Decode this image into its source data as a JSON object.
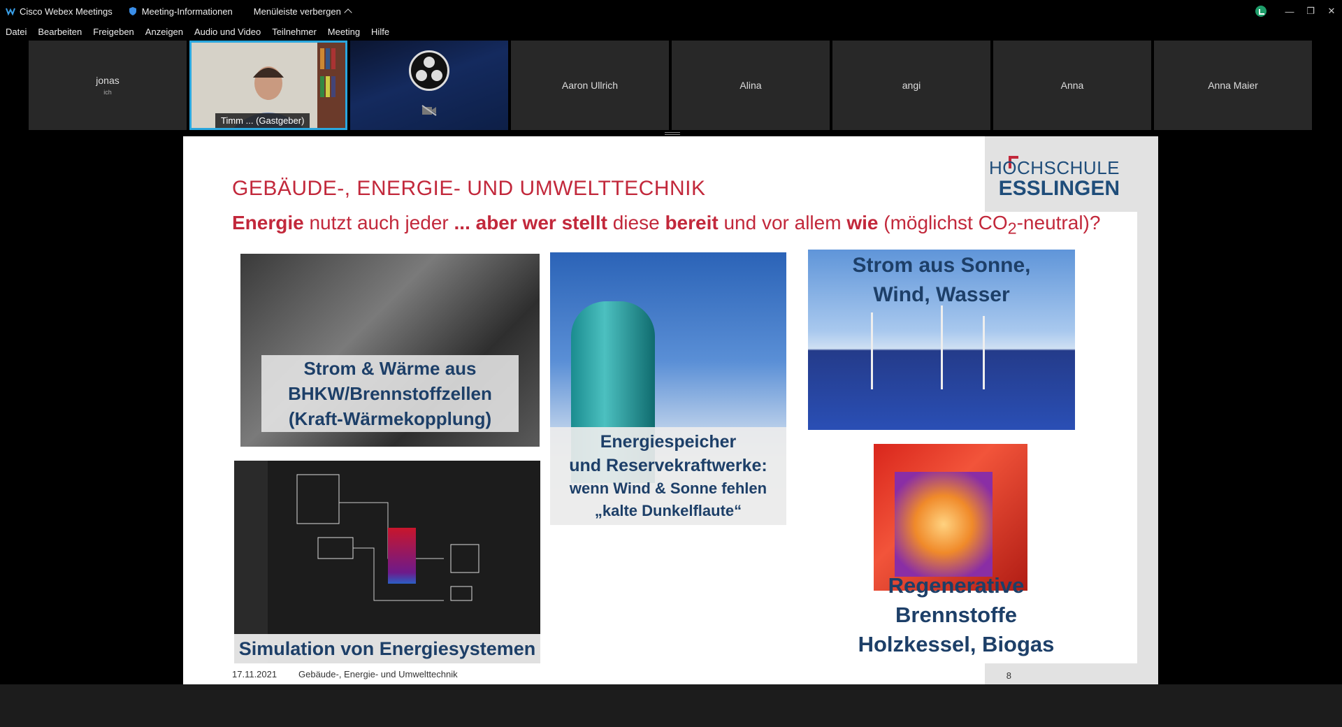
{
  "titlebar": {
    "app_title": "Cisco Webex Meetings",
    "meeting_info": "Meeting-Informationen",
    "hide_menu": "Menüleiste verbergen"
  },
  "menu": [
    "Datei",
    "Bearbeiten",
    "Freigeben",
    "Anzeigen",
    "Audio und Video",
    "Teilnehmer",
    "Meeting",
    "Hilfe"
  ],
  "participants": [
    {
      "name": "jonas",
      "sub": "ich"
    },
    {
      "name": "Timm ...  (Gastgeber)"
    },
    {
      "name": ""
    },
    {
      "name": "Aaron Ullrich"
    },
    {
      "name": "Alina"
    },
    {
      "name": "angi"
    },
    {
      "name": "Anna"
    },
    {
      "name": "Anna Maier"
    }
  ],
  "slide": {
    "logo_line1": "HOCHSCHULE",
    "logo_line2": "ESSLINGEN",
    "heading": "GEBÄUDE-, ENERGIE- UND UMWELTTECHNIK",
    "sub": {
      "p1": "Energie",
      "p2": " nutzt auch jeder ",
      "p3": "... aber wer stellt",
      "p4": " diese ",
      "p5": "bereit",
      "p6": " und vor allem ",
      "p7": "wie",
      "p8": " (möglichst CO",
      "p9": "2",
      "p10": "-neutral)?"
    },
    "panel1": [
      "Strom & Wärme aus",
      "BHKW/Brennstoffzellen",
      "(Kraft-Wärmekopplung)"
    ],
    "panel2": [
      "Energiespeicher",
      "und Reservekraftwerke:",
      "wenn Wind & Sonne fehlen",
      "„kalte Dunkelflaute“"
    ],
    "panel3": [
      "Strom aus  Sonne,",
      "Wind, Wasser"
    ],
    "panel4": "Simulation von Energiesystemen",
    "panel5": [
      "Regenerative Brennstoffe",
      "Holzkessel, Biogas"
    ],
    "footer_date": "17.11.2021",
    "footer_title": "Gebäude-, Energie- und Umwelttechnik",
    "page": "8"
  },
  "colors": {
    "accent_red": "#c2283b",
    "navy": "#1d3f68",
    "active_tile": "#2aa7de"
  }
}
